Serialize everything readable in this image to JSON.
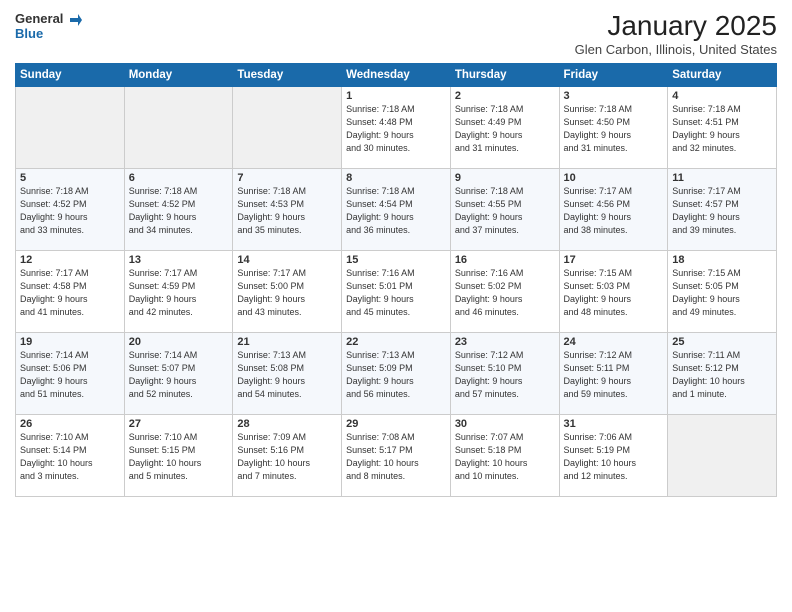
{
  "logo": {
    "general": "General",
    "blue": "Blue"
  },
  "title": "January 2025",
  "subtitle": "Glen Carbon, Illinois, United States",
  "days_header": [
    "Sunday",
    "Monday",
    "Tuesday",
    "Wednesday",
    "Thursday",
    "Friday",
    "Saturday"
  ],
  "weeks": [
    [
      {
        "day": "",
        "info": ""
      },
      {
        "day": "",
        "info": ""
      },
      {
        "day": "",
        "info": ""
      },
      {
        "day": "1",
        "info": "Sunrise: 7:18 AM\nSunset: 4:48 PM\nDaylight: 9 hours\nand 30 minutes."
      },
      {
        "day": "2",
        "info": "Sunrise: 7:18 AM\nSunset: 4:49 PM\nDaylight: 9 hours\nand 31 minutes."
      },
      {
        "day": "3",
        "info": "Sunrise: 7:18 AM\nSunset: 4:50 PM\nDaylight: 9 hours\nand 31 minutes."
      },
      {
        "day": "4",
        "info": "Sunrise: 7:18 AM\nSunset: 4:51 PM\nDaylight: 9 hours\nand 32 minutes."
      }
    ],
    [
      {
        "day": "5",
        "info": "Sunrise: 7:18 AM\nSunset: 4:52 PM\nDaylight: 9 hours\nand 33 minutes."
      },
      {
        "day": "6",
        "info": "Sunrise: 7:18 AM\nSunset: 4:52 PM\nDaylight: 9 hours\nand 34 minutes."
      },
      {
        "day": "7",
        "info": "Sunrise: 7:18 AM\nSunset: 4:53 PM\nDaylight: 9 hours\nand 35 minutes."
      },
      {
        "day": "8",
        "info": "Sunrise: 7:18 AM\nSunset: 4:54 PM\nDaylight: 9 hours\nand 36 minutes."
      },
      {
        "day": "9",
        "info": "Sunrise: 7:18 AM\nSunset: 4:55 PM\nDaylight: 9 hours\nand 37 minutes."
      },
      {
        "day": "10",
        "info": "Sunrise: 7:17 AM\nSunset: 4:56 PM\nDaylight: 9 hours\nand 38 minutes."
      },
      {
        "day": "11",
        "info": "Sunrise: 7:17 AM\nSunset: 4:57 PM\nDaylight: 9 hours\nand 39 minutes."
      }
    ],
    [
      {
        "day": "12",
        "info": "Sunrise: 7:17 AM\nSunset: 4:58 PM\nDaylight: 9 hours\nand 41 minutes."
      },
      {
        "day": "13",
        "info": "Sunrise: 7:17 AM\nSunset: 4:59 PM\nDaylight: 9 hours\nand 42 minutes."
      },
      {
        "day": "14",
        "info": "Sunrise: 7:17 AM\nSunset: 5:00 PM\nDaylight: 9 hours\nand 43 minutes."
      },
      {
        "day": "15",
        "info": "Sunrise: 7:16 AM\nSunset: 5:01 PM\nDaylight: 9 hours\nand 45 minutes."
      },
      {
        "day": "16",
        "info": "Sunrise: 7:16 AM\nSunset: 5:02 PM\nDaylight: 9 hours\nand 46 minutes."
      },
      {
        "day": "17",
        "info": "Sunrise: 7:15 AM\nSunset: 5:03 PM\nDaylight: 9 hours\nand 48 minutes."
      },
      {
        "day": "18",
        "info": "Sunrise: 7:15 AM\nSunset: 5:05 PM\nDaylight: 9 hours\nand 49 minutes."
      }
    ],
    [
      {
        "day": "19",
        "info": "Sunrise: 7:14 AM\nSunset: 5:06 PM\nDaylight: 9 hours\nand 51 minutes."
      },
      {
        "day": "20",
        "info": "Sunrise: 7:14 AM\nSunset: 5:07 PM\nDaylight: 9 hours\nand 52 minutes."
      },
      {
        "day": "21",
        "info": "Sunrise: 7:13 AM\nSunset: 5:08 PM\nDaylight: 9 hours\nand 54 minutes."
      },
      {
        "day": "22",
        "info": "Sunrise: 7:13 AM\nSunset: 5:09 PM\nDaylight: 9 hours\nand 56 minutes."
      },
      {
        "day": "23",
        "info": "Sunrise: 7:12 AM\nSunset: 5:10 PM\nDaylight: 9 hours\nand 57 minutes."
      },
      {
        "day": "24",
        "info": "Sunrise: 7:12 AM\nSunset: 5:11 PM\nDaylight: 9 hours\nand 59 minutes."
      },
      {
        "day": "25",
        "info": "Sunrise: 7:11 AM\nSunset: 5:12 PM\nDaylight: 10 hours\nand 1 minute."
      }
    ],
    [
      {
        "day": "26",
        "info": "Sunrise: 7:10 AM\nSunset: 5:14 PM\nDaylight: 10 hours\nand 3 minutes."
      },
      {
        "day": "27",
        "info": "Sunrise: 7:10 AM\nSunset: 5:15 PM\nDaylight: 10 hours\nand 5 minutes."
      },
      {
        "day": "28",
        "info": "Sunrise: 7:09 AM\nSunset: 5:16 PM\nDaylight: 10 hours\nand 7 minutes."
      },
      {
        "day": "29",
        "info": "Sunrise: 7:08 AM\nSunset: 5:17 PM\nDaylight: 10 hours\nand 8 minutes."
      },
      {
        "day": "30",
        "info": "Sunrise: 7:07 AM\nSunset: 5:18 PM\nDaylight: 10 hours\nand 10 minutes."
      },
      {
        "day": "31",
        "info": "Sunrise: 7:06 AM\nSunset: 5:19 PM\nDaylight: 10 hours\nand 12 minutes."
      },
      {
        "day": "",
        "info": ""
      }
    ]
  ]
}
